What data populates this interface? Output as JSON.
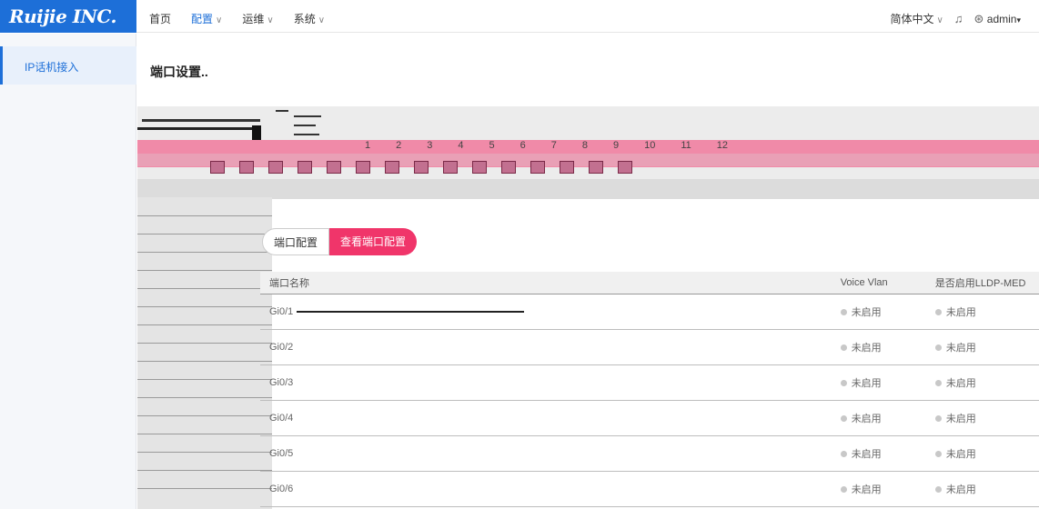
{
  "header": {
    "logo": "Ruijie INC.",
    "nav": [
      {
        "label": "首页",
        "active": false,
        "dropdown": false
      },
      {
        "label": "配置",
        "active": true,
        "dropdown": true
      },
      {
        "label": "运维",
        "active": false,
        "dropdown": true
      },
      {
        "label": "系统",
        "active": false,
        "dropdown": true
      }
    ],
    "language": "简体中文",
    "user": "admin"
  },
  "sidebar": {
    "items": [
      {
        "label": "IP话机接入",
        "active": true
      }
    ]
  },
  "main": {
    "title": "端口设置..",
    "port_numbers": [
      "1",
      "2",
      "3",
      "4",
      "5",
      "6",
      "7",
      "8",
      "9",
      "10",
      "11",
      "12"
    ],
    "buttons": {
      "port_config": "端口配置",
      "view_port_config": "查看端口配置"
    },
    "table": {
      "headers": [
        "端口名称",
        "Voice Vlan",
        "是否启用LLDP-MED"
      ],
      "rows": [
        {
          "name": "Gi0/1",
          "voice_vlan": "未启用",
          "lldp_med": "未启用"
        },
        {
          "name": "Gi0/2",
          "voice_vlan": "未启用",
          "lldp_med": "未启用"
        },
        {
          "name": "Gi0/3",
          "voice_vlan": "未启用",
          "lldp_med": "未启用"
        },
        {
          "name": "Gi0/4",
          "voice_vlan": "未启用",
          "lldp_med": "未启用"
        },
        {
          "name": "Gi0/5",
          "voice_vlan": "未启用",
          "lldp_med": "未启用"
        },
        {
          "name": "Gi0/6",
          "voice_vlan": "未启用",
          "lldp_med": "未启用"
        }
      ]
    }
  },
  "colors": {
    "brand": "#1d6fd8",
    "accent": "#f0356a"
  }
}
